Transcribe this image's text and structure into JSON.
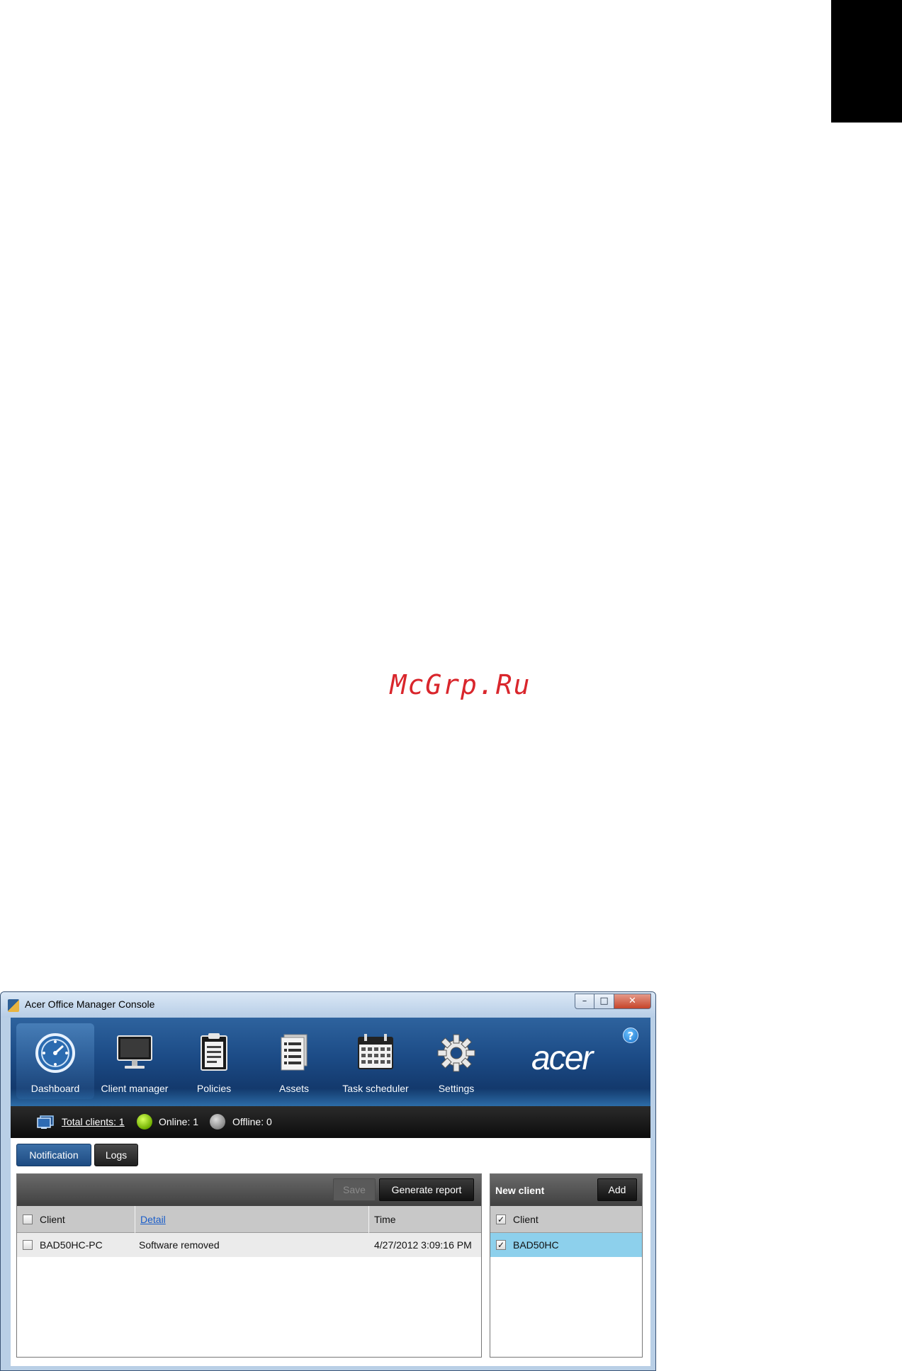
{
  "window": {
    "title": "Acer Office Manager Console",
    "controls": {
      "minimize": "–",
      "maximize": "□",
      "close": "✕"
    }
  },
  "nav": {
    "items": [
      {
        "label": "Dashboard",
        "icon": "dashboard-icon",
        "active": true
      },
      {
        "label": "Client manager",
        "icon": "monitor-icon",
        "active": false
      },
      {
        "label": "Policies",
        "icon": "clipboard-icon",
        "active": false
      },
      {
        "label": "Assets",
        "icon": "document-list-icon",
        "active": false
      },
      {
        "label": "Task scheduler",
        "icon": "calendar-icon",
        "active": false
      },
      {
        "label": "Settings",
        "icon": "gear-icon",
        "active": false
      }
    ],
    "logo": "acer",
    "help": "?"
  },
  "status": {
    "total_clients": "Total clients: 1",
    "online": "Online: 1",
    "offline": "Offline: 0"
  },
  "tabs": [
    {
      "label": "Notification",
      "active": true
    },
    {
      "label": "Logs",
      "active": false
    }
  ],
  "notification_panel": {
    "save_label": "Save",
    "report_label": "Generate report",
    "columns": {
      "client": "Client",
      "detail": "Detail",
      "time": "Time"
    },
    "rows": [
      {
        "client": "BAD50HC-PC",
        "detail": "Software removed",
        "time": "4/27/2012 3:09:16 PM",
        "checked": false
      }
    ]
  },
  "new_client_panel": {
    "title": "New client",
    "add_label": "Add",
    "column": "Client",
    "header_checked": true,
    "rows": [
      {
        "client": "BAD50HC",
        "checked": true
      }
    ]
  },
  "watermark": "McGrp.Ru",
  "colors": {
    "nav_blue": "#1c4b86",
    "tab_active": "#2d5f98",
    "selected_row": "#8dd0ec",
    "link": "#1a5dc9",
    "online": "#8bd000",
    "offline": "#8a8a8a",
    "watermark": "#d9262c"
  }
}
